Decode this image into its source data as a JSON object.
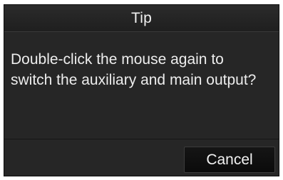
{
  "dialog": {
    "title": "Tip",
    "message_line1": "Double-click the mouse again to",
    "message_line2": "switch the auxiliary and main output?",
    "cancel_label": "Cancel"
  },
  "colors": {
    "dialog_background": "#262626",
    "text": "#ededed",
    "button_background": "#111111"
  }
}
